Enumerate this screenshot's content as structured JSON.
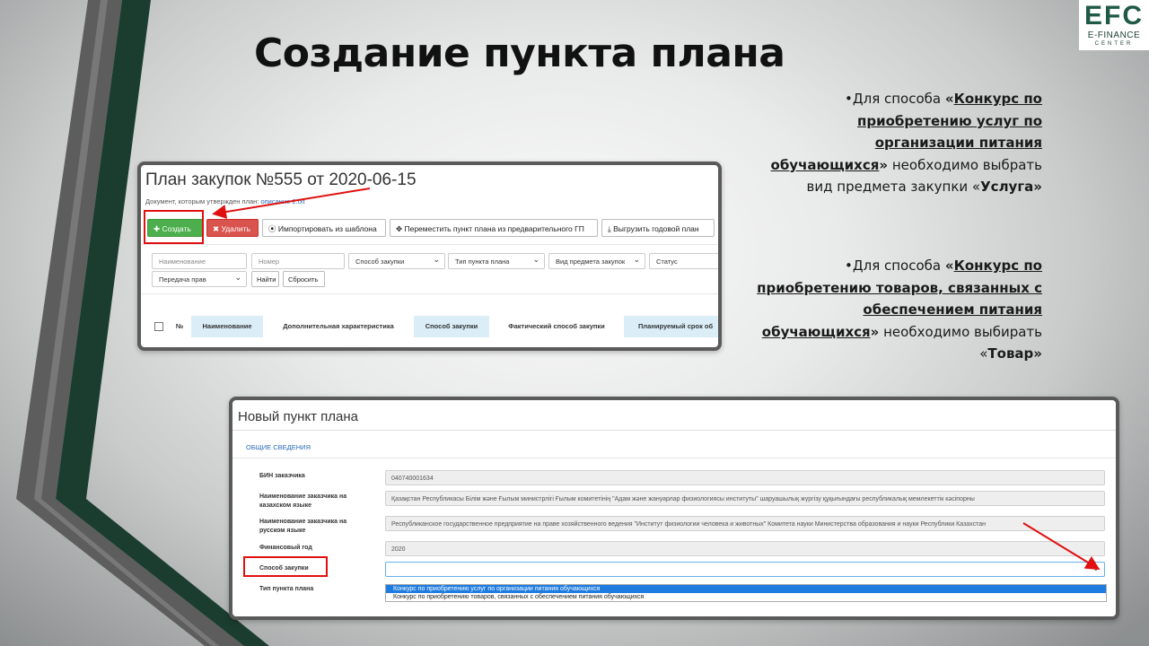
{
  "slide": {
    "title": "Создание пункта плана",
    "colors": {
      "dark_green": "#1b3d30",
      "grey_stripe": "#5d5d5d",
      "accent_red": "#e01010"
    }
  },
  "logo": {
    "big": "EFC",
    "line1": "E-FINANCE",
    "line2": "CENTER"
  },
  "notes": [
    {
      "prefix": "Для способа ",
      "quote_open": "«",
      "emph": "Конкурс по приобретению услуг по организации питания обучающихся",
      "quote_close": "»",
      "rest": " необходимо выбрать вид предмета закупки «",
      "item": "Услуга",
      "end": "»"
    },
    {
      "prefix": "Для способа ",
      "quote_open": "«",
      "emph": "Конкурс по приобретению товаров, связанных с обеспечением питания обучающихся",
      "quote_close": "»",
      "rest": " необходимо выбирать «",
      "item": "Товар",
      "end": "»"
    }
  ],
  "plan_screen": {
    "header": "План закупок №555 от 2020-06-15",
    "doc_prefix": "Документ, которым утвержден план: ",
    "doc_link": "описание 2.txt",
    "buttons": {
      "create": "Создать",
      "delete": "Удалить",
      "import": "Импортировать из шаблона",
      "move": "Переместить пункт плана из предварительного ГП",
      "export": "Выгрузить годовой план",
      "find": "Найти",
      "reset": "Сбросить"
    },
    "filters": {
      "name": "Наименование",
      "number": "Номер",
      "method": "Способ закупки",
      "type": "Тип пункта плана",
      "subject": "Вид предмета закупок",
      "status": "Статус",
      "transfer": "Передача прав"
    },
    "columns": [
      "№",
      "Наименование",
      "Дополнительная характеристика",
      "Способ закупки",
      "Фактический способ закупки",
      "Планируемый срок об"
    ]
  },
  "new_item_screen": {
    "header": "Новый пункт плана",
    "section": "ОБЩИЕ СВЕДЕНИЯ",
    "fields": [
      {
        "label": "БИН заказчика",
        "value": "040740001634"
      },
      {
        "label": "Наименование заказчика на казахском языке",
        "value": "Қазақстан Республикасы Білім және Ғылым министрлігі Ғылым комитетінің \"Адам және жануарлар физиологиясы институты\" шаруашылық жүргізу құқығындағы республикалық мемлекеттік кәсіпорны"
      },
      {
        "label": "Наименование заказчика на русском языке",
        "value": "Республиканское государственное предприятие на праве хозяйственного ведения \"Институт физиологии человека и животных\" Комитета науки Министерства образования и науки Республики Казахстан"
      },
      {
        "label": "Финансовый год",
        "value": "2020"
      },
      {
        "label": "Способ закупки",
        "value": ""
      },
      {
        "label": "Тип пункта плана",
        "value": ""
      }
    ],
    "dropdown_options": [
      "Конкурс по приобретению услуг по организации питания обучающихся",
      "Конкурс по приобретению товаров, связанных с обеспечением питания обучающихся"
    ],
    "selected_option": 0
  }
}
